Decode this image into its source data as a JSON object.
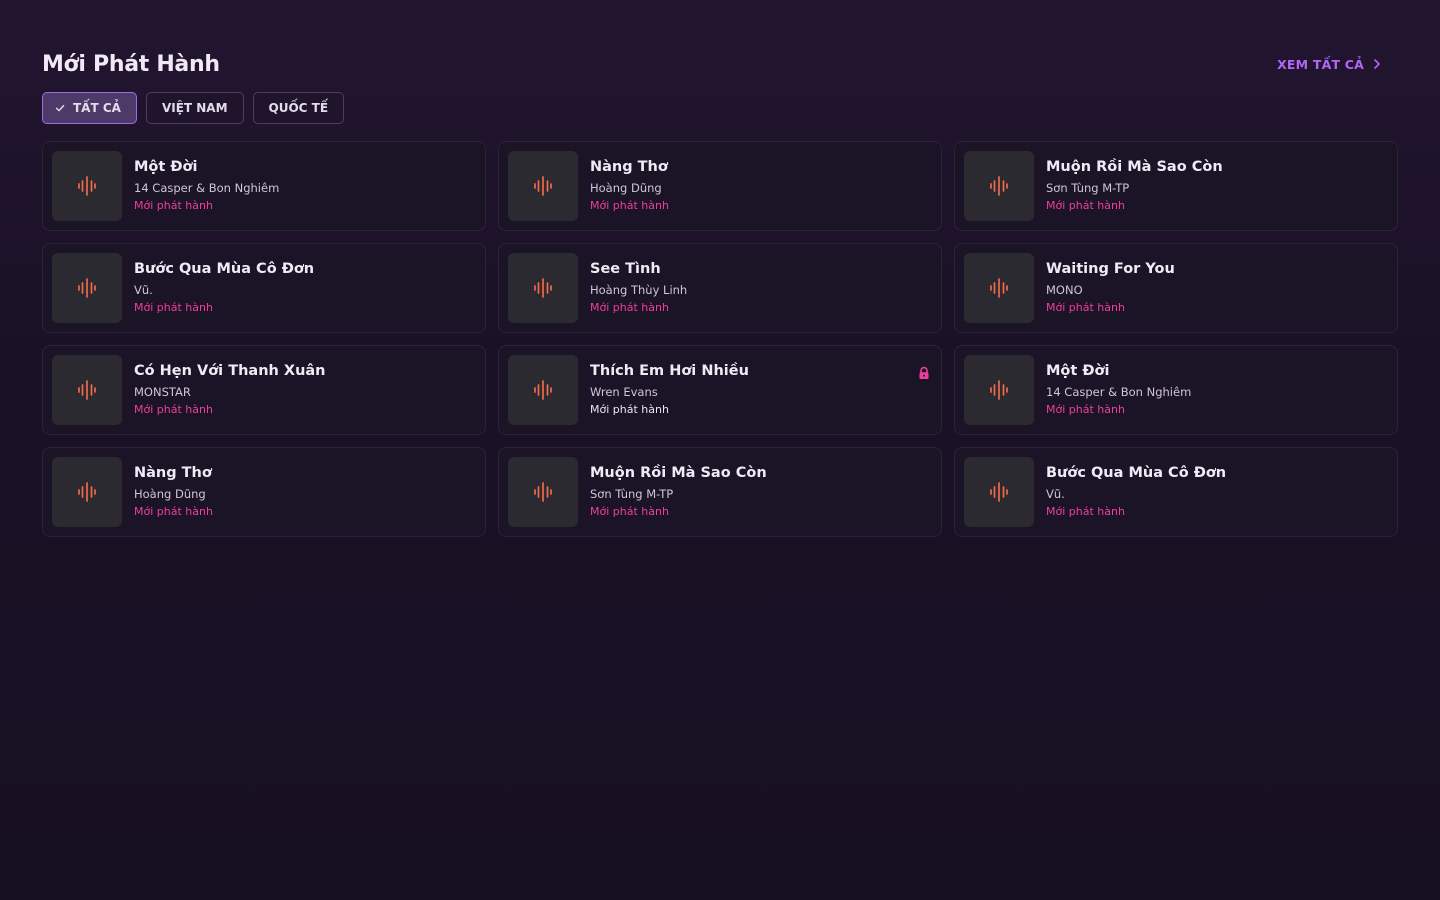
{
  "section": {
    "title": "Mới Phát Hành",
    "see_all_label": "XEM TẤT CẢ"
  },
  "filters": [
    {
      "label": "TẤT CẢ",
      "active": true
    },
    {
      "label": "VIỆT NAM",
      "active": false
    },
    {
      "label": "QUỐC TẾ",
      "active": false
    }
  ],
  "colors": {
    "accent_purple": "#b365f5",
    "tag_pink": "#ee3f9e",
    "waveform": "#ef6a4a",
    "background": "#1a1126"
  },
  "icons": {
    "thumbnail": "audio-waveform-icon",
    "lock": "lock-icon",
    "check": "check-icon",
    "chevron": "chevron-right-icon"
  },
  "songs": [
    {
      "title": "Một Đời",
      "artist": "14 Casper & Bon Nghiêm",
      "tag": "Mới phát hành",
      "locked": false
    },
    {
      "title": "Nàng Thơ",
      "artist": "Hoàng Dũng",
      "tag": "Mới phát hành",
      "locked": false
    },
    {
      "title": "Muộn Rồi Mà Sao Còn",
      "artist": "Sơn Tùng M-TP",
      "tag": "Mới phát hành",
      "locked": false
    },
    {
      "title": "Bước Qua Mùa Cô Đơn",
      "artist": "Vũ.",
      "tag": "Mới phát hành",
      "locked": false
    },
    {
      "title": "See Tình",
      "artist": "Hoàng Thùy Linh",
      "tag": "Mới phát hành",
      "locked": false
    },
    {
      "title": "Waiting For You",
      "artist": "MONO",
      "tag": "Mới phát hành",
      "locked": false
    },
    {
      "title": "Có Hẹn Với Thanh Xuân",
      "artist": "MONSTAR",
      "tag": "Mới phát hành",
      "locked": false
    },
    {
      "title": "Thích Em Hơi Nhiều",
      "artist": "Wren Evans",
      "tag": "Mới phát hành",
      "locked": true
    },
    {
      "title": "Một Đời",
      "artist": "14 Casper & Bon Nghiêm",
      "tag": "Mới phát hành",
      "locked": false
    },
    {
      "title": "Nàng Thơ",
      "artist": "Hoàng Dũng",
      "tag": "Mới phát hành",
      "locked": false
    },
    {
      "title": "Muộn Rồi Mà Sao Còn",
      "artist": "Sơn Tùng M-TP",
      "tag": "Mới phát hành",
      "locked": false
    },
    {
      "title": "Bước Qua Mùa Cô Đơn",
      "artist": "Vũ.",
      "tag": "Mới phát hành",
      "locked": false
    }
  ]
}
